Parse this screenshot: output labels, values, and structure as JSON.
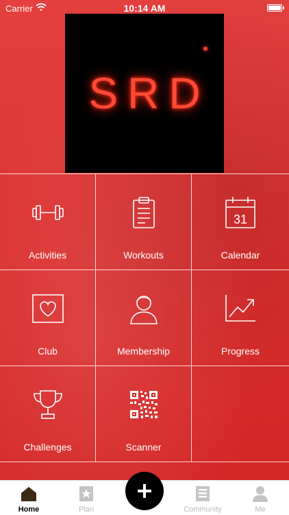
{
  "status_bar": {
    "carrier": "Carrier",
    "time": "10:14 AM"
  },
  "logo": {
    "text": "SRD"
  },
  "tiles": [
    {
      "label": "Activities",
      "icon": "dumbbell-icon"
    },
    {
      "label": "Workouts",
      "icon": "clipboard-icon"
    },
    {
      "label": "Calendar",
      "icon": "calendar-icon",
      "icon_text": "31"
    },
    {
      "label": "Club",
      "icon": "heart-icon"
    },
    {
      "label": "Membership",
      "icon": "person-icon"
    },
    {
      "label": "Progress",
      "icon": "trend-chart-icon"
    },
    {
      "label": "Challenges",
      "icon": "trophy-icon"
    },
    {
      "label": "Scanner",
      "icon": "qr-code-icon"
    }
  ],
  "tabbar": {
    "items": [
      {
        "label": "Home",
        "icon": "home-icon",
        "active": true
      },
      {
        "label": "Plan",
        "icon": "star-page-icon",
        "active": false
      },
      {
        "label": "Community",
        "icon": "news-icon",
        "active": false
      },
      {
        "label": "Me",
        "icon": "profile-icon",
        "active": false
      }
    ],
    "fab_icon": "plus-icon"
  },
  "colors": {
    "accent": "#d92b2b",
    "tab_active": "#000000",
    "tab_inactive": "#b9b9b9"
  }
}
